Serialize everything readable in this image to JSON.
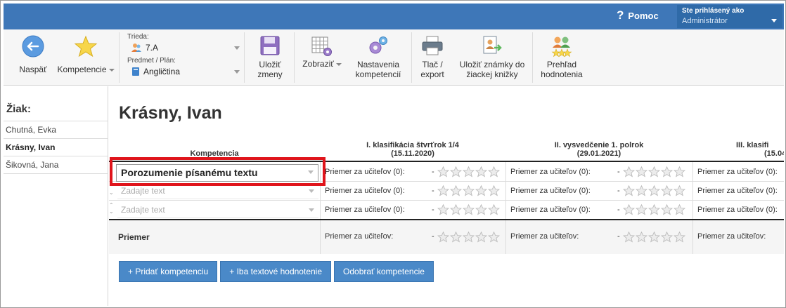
{
  "topbar": {
    "help_label": "Pomoc",
    "user_caption": "Ste prihlásený ako",
    "user_name": "Administrátor"
  },
  "toolbar": {
    "back_label": "Naspäť",
    "competencies_label": "Kompetencie",
    "class_caption": "Trieda:",
    "class_value": "7.A",
    "subject_caption": "Predmet / Plán:",
    "subject_value": "Angličtina",
    "save_line1": "Uložiť",
    "save_line2": "zmeny",
    "show_label": "Zobraziť",
    "settings_line1": "Nastavenia",
    "settings_line2": "kompetencií",
    "print_line1": "Tlač /",
    "print_line2": "export",
    "store_line1": "Uložiť známky do",
    "store_line2": "žiackej knižky",
    "overview_line1": "Prehľad",
    "overview_line2": "hodnotenia"
  },
  "sidebar": {
    "title": "Žiak:",
    "students": [
      "Chutná, Evka",
      "Krásny, Ivan",
      "Šikovná, Jana"
    ],
    "active_index": 1
  },
  "main": {
    "student_name": "Krásny, Ivan",
    "competence_header": "Kompetencia",
    "periods": [
      {
        "title": "I. klasifikácia štvrťrok 1/4",
        "date": "(15.11.2020)"
      },
      {
        "title": "II. vysvedčenie 1. polrok",
        "date": "(29.01.2021)"
      },
      {
        "title": "III. klasifi",
        "date": "(15.04"
      }
    ],
    "rows": [
      {
        "competence": "Porozumenie písanému textu",
        "placeholder": ""
      },
      {
        "competence": "",
        "placeholder": "Zadajte text"
      },
      {
        "competence": "",
        "placeholder": "Zadajte text"
      }
    ],
    "row_cell_label": "Priemer za učiteľov (0):",
    "row_cell_dash": "-",
    "avg_label": "Priemer",
    "avg_cell_label": "Priemer za učiteľov:",
    "avg_cell_dash": "-",
    "stars_count": 5,
    "buttons": {
      "add_competence": "+ Pridať kompetenciu",
      "text_only": "+ Iba textové hodnotenie",
      "remove_competence": "Odobrať kompetencie"
    }
  },
  "colors": {
    "topbar": "#3e77b8",
    "button": "#4a89c8",
    "highlight": "#e0141b"
  }
}
